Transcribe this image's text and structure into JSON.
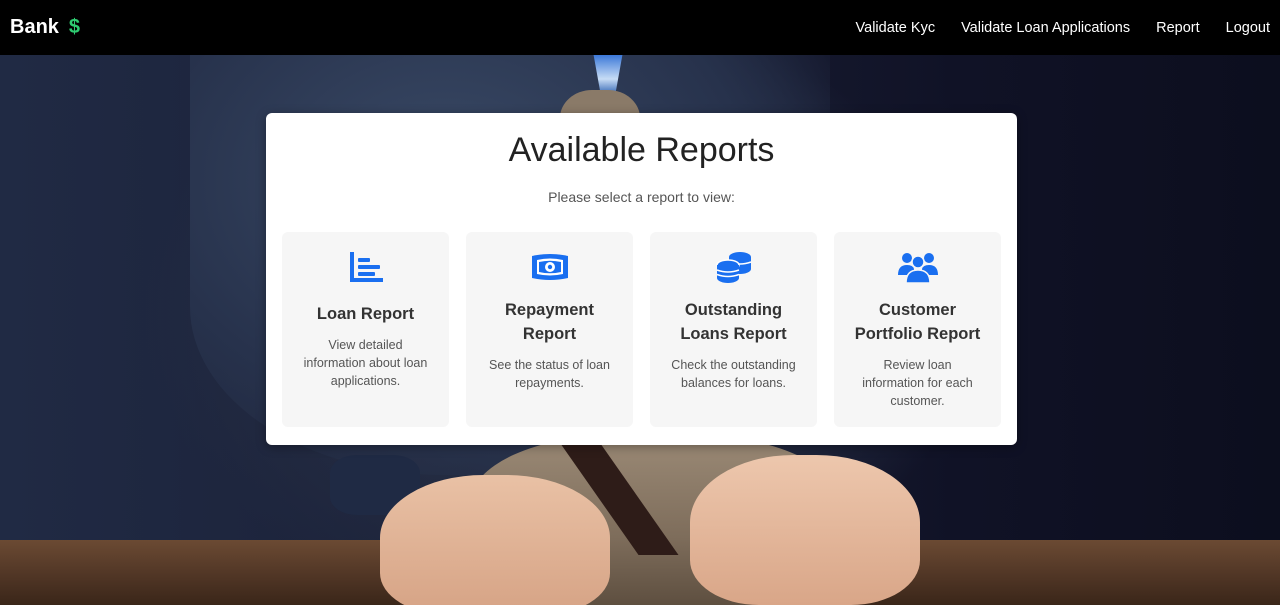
{
  "navbar": {
    "brand": "Bank",
    "brand_icon": "dollar-icon",
    "brand_icon_glyph": "$",
    "links": [
      "Validate Kyc",
      "Validate Loan Applications",
      "Report",
      "Logout"
    ]
  },
  "card": {
    "title": "Available Reports",
    "subtitle": "Please select a report to view:",
    "reports": [
      {
        "icon": "bar-chart-icon",
        "title": "Loan Report",
        "description": "View detailed information about loan applications."
      },
      {
        "icon": "money-bill-icon",
        "title": "Repayment Report",
        "description": "See the status of loan repayments."
      },
      {
        "icon": "coins-icon",
        "title": "Outstanding Loans Report",
        "description": "Check the outstanding balances for loans."
      },
      {
        "icon": "users-icon",
        "title": "Customer Portfolio Report",
        "description": "Review loan information for each customer."
      }
    ]
  },
  "colors": {
    "accent": "#1a6ff0",
    "brand_icon": "#2ecc71",
    "navbar": "#000000"
  }
}
